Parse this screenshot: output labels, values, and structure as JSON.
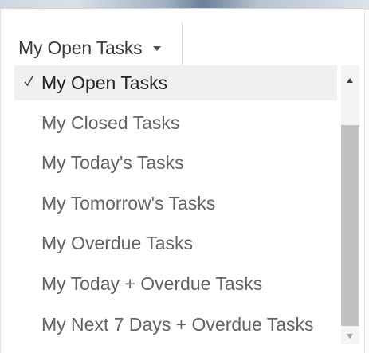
{
  "view_selector": {
    "label": "My Open Tasks",
    "icon": "caret-down-icon"
  },
  "menu": {
    "selected_index": 0,
    "check_icon": "checkmark-icon",
    "options": [
      {
        "label": "My Open Tasks",
        "selected": true
      },
      {
        "label": "My Closed Tasks",
        "selected": false
      },
      {
        "label": "My Today's Tasks",
        "selected": false
      },
      {
        "label": "My Tomorrow's Tasks",
        "selected": false
      },
      {
        "label": "My Overdue Tasks",
        "selected": false
      },
      {
        "label": "My Today + Overdue Tasks",
        "selected": false
      },
      {
        "label": "My Next 7 Days + Overdue Tasks",
        "selected": false
      }
    ]
  },
  "colors": {
    "selected_bg": "#f0f0f0",
    "text": "#5f6368",
    "selected_text": "#202124",
    "scrollbar_thumb": "#c1c1c1"
  }
}
